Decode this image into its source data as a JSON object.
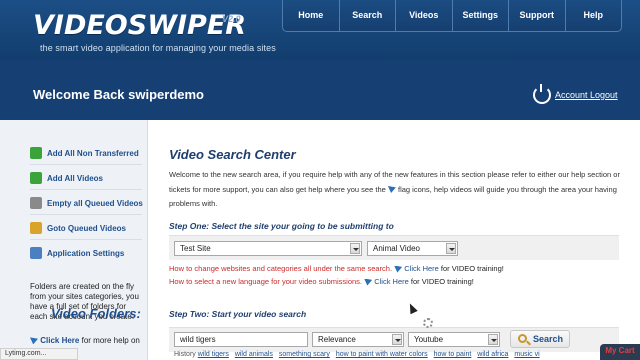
{
  "brand": {
    "logo": "VIDEOSWIPER",
    "version": "V2.0",
    "tagline": "the smart video application for managing your media sites"
  },
  "nav": [
    "Home",
    "Search",
    "Videos",
    "Settings",
    "Support",
    "Help"
  ],
  "band": {
    "welcome": "Welcome Back swiperdemo",
    "logout": "Account Logout"
  },
  "sidebar": {
    "items": [
      {
        "label": "Add All Non Transferred",
        "icon": "add-green-icon"
      },
      {
        "label": "Add All Videos",
        "icon": "add-green-icon"
      },
      {
        "label": "Empty all Queued Videos",
        "icon": "trash-icon"
      },
      {
        "label": "Goto Queued Videos",
        "icon": "queue-icon"
      },
      {
        "label": "Application Settings",
        "icon": "settings-icon"
      }
    ],
    "folders_title": "Video Folders:",
    "folders_text": "Folders are created on the fly from your sites categories, you have a full set of folders for each site account you create.",
    "click_here": "Click Here",
    "click_here_rest": "for more help on"
  },
  "main": {
    "title": "Video Search Center",
    "intro_1": "Welcome to the new search area, if you require help with any of the new features in this section please refer to either our help section or tickets for more support, you can also get help where you see the",
    "intro_2": "flag icons, help videos will guide you through the area your having problems with.",
    "step1": "Step One: Select the site your going to be submitting to",
    "site_select": "Test Site",
    "category_select": "Animal Video",
    "help1_red": "How to change websites and categories all under the same search.",
    "help1_link": "Click Here",
    "help1_rest": "for VIDEO training!",
    "help2_red": "How to select a new language for your video submissions.",
    "help2_link": "Click Here",
    "help2_rest": "for VIDEO training!",
    "step2": "Step Two: Start your video search",
    "search_value": "wild tigers",
    "sort_select": "Relevance",
    "source_select": "Youtube",
    "search_button": "Search",
    "history_label": "History",
    "history": [
      "wild tigers",
      "wild animals",
      "something scary",
      "how to paint with water colors",
      "how to paint",
      "wild africa",
      "music vi"
    ]
  },
  "status": {
    "text": "Lytimg.com...",
    "cart": "My Cart"
  },
  "colors": {
    "header": "#1c4f86",
    "band": "#163f73",
    "link": "#1f4f8c",
    "help_red": "#cc2a2a",
    "sidebar_bg": "#eef2f6"
  }
}
